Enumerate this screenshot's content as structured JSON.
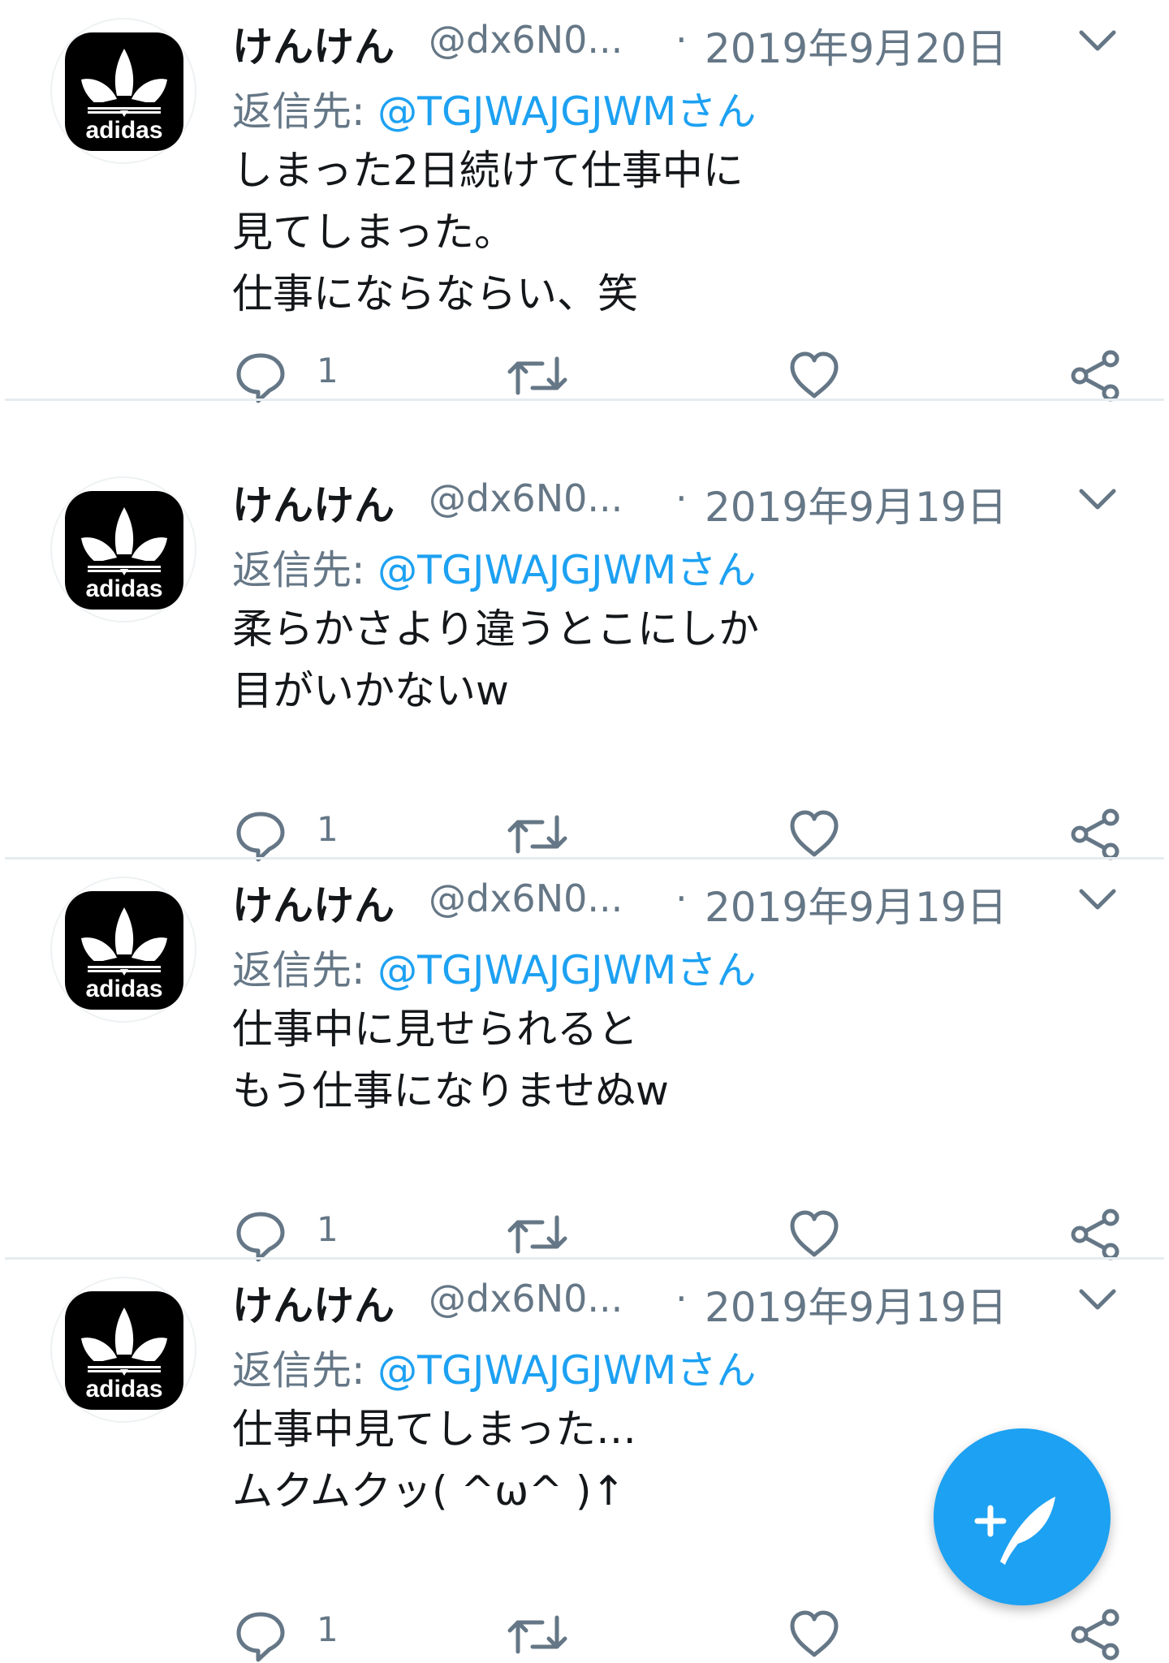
{
  "tweets": [
    {
      "name": "けんけん",
      "handle": "@dx6N0...",
      "dot": "·",
      "date": "2019年9月20日",
      "reply_prefix": "返信先: ",
      "reply_to": "@TGJWAJGJWMさん",
      "lines": [
        "しまった2日続けて仕事中に",
        "見てしまった。",
        "仕事にならならい、笑"
      ],
      "reply_count": "1"
    },
    {
      "name": "けんけん",
      "handle": "@dx6N0...",
      "dot": "·",
      "date": "2019年9月19日",
      "reply_prefix": "返信先: ",
      "reply_to": "@TGJWAJGJWMさん",
      "lines": [
        "柔らかさより違うとこにしか",
        "目がいかないw"
      ],
      "reply_count": "1"
    },
    {
      "name": "けんけん",
      "handle": "@dx6N0...",
      "dot": "·",
      "date": "2019年9月19日",
      "reply_prefix": "返信先: ",
      "reply_to": "@TGJWAJGJWMさん",
      "lines": [
        "仕事中に見せられると",
        "もう仕事になりませぬw"
      ],
      "reply_count": "1"
    },
    {
      "name": "けんけん",
      "handle": "@dx6N0...",
      "dot": "·",
      "date": "2019年9月19日",
      "reply_prefix": "返信先: ",
      "reply_to": "@TGJWAJGJWMさん",
      "lines": [
        "仕事中見てしまった…",
        "ムクムクッ( ^ω^ )↑"
      ],
      "reply_count": "1"
    }
  ],
  "avatar_logo_text": "adidas",
  "icons": {
    "avatar": "adidas-trefoil-logo",
    "menu": "chevron-down-icon",
    "reply": "reply-bubble-icon",
    "retweet": "retweet-icon",
    "like": "heart-icon",
    "share": "share-icon",
    "compose": "compose-tweet-icon"
  },
  "colors": {
    "accent": "#1da1f2",
    "secondary_text": "#657786",
    "primary_text": "#14171a",
    "divider": "#e6ecf0"
  }
}
